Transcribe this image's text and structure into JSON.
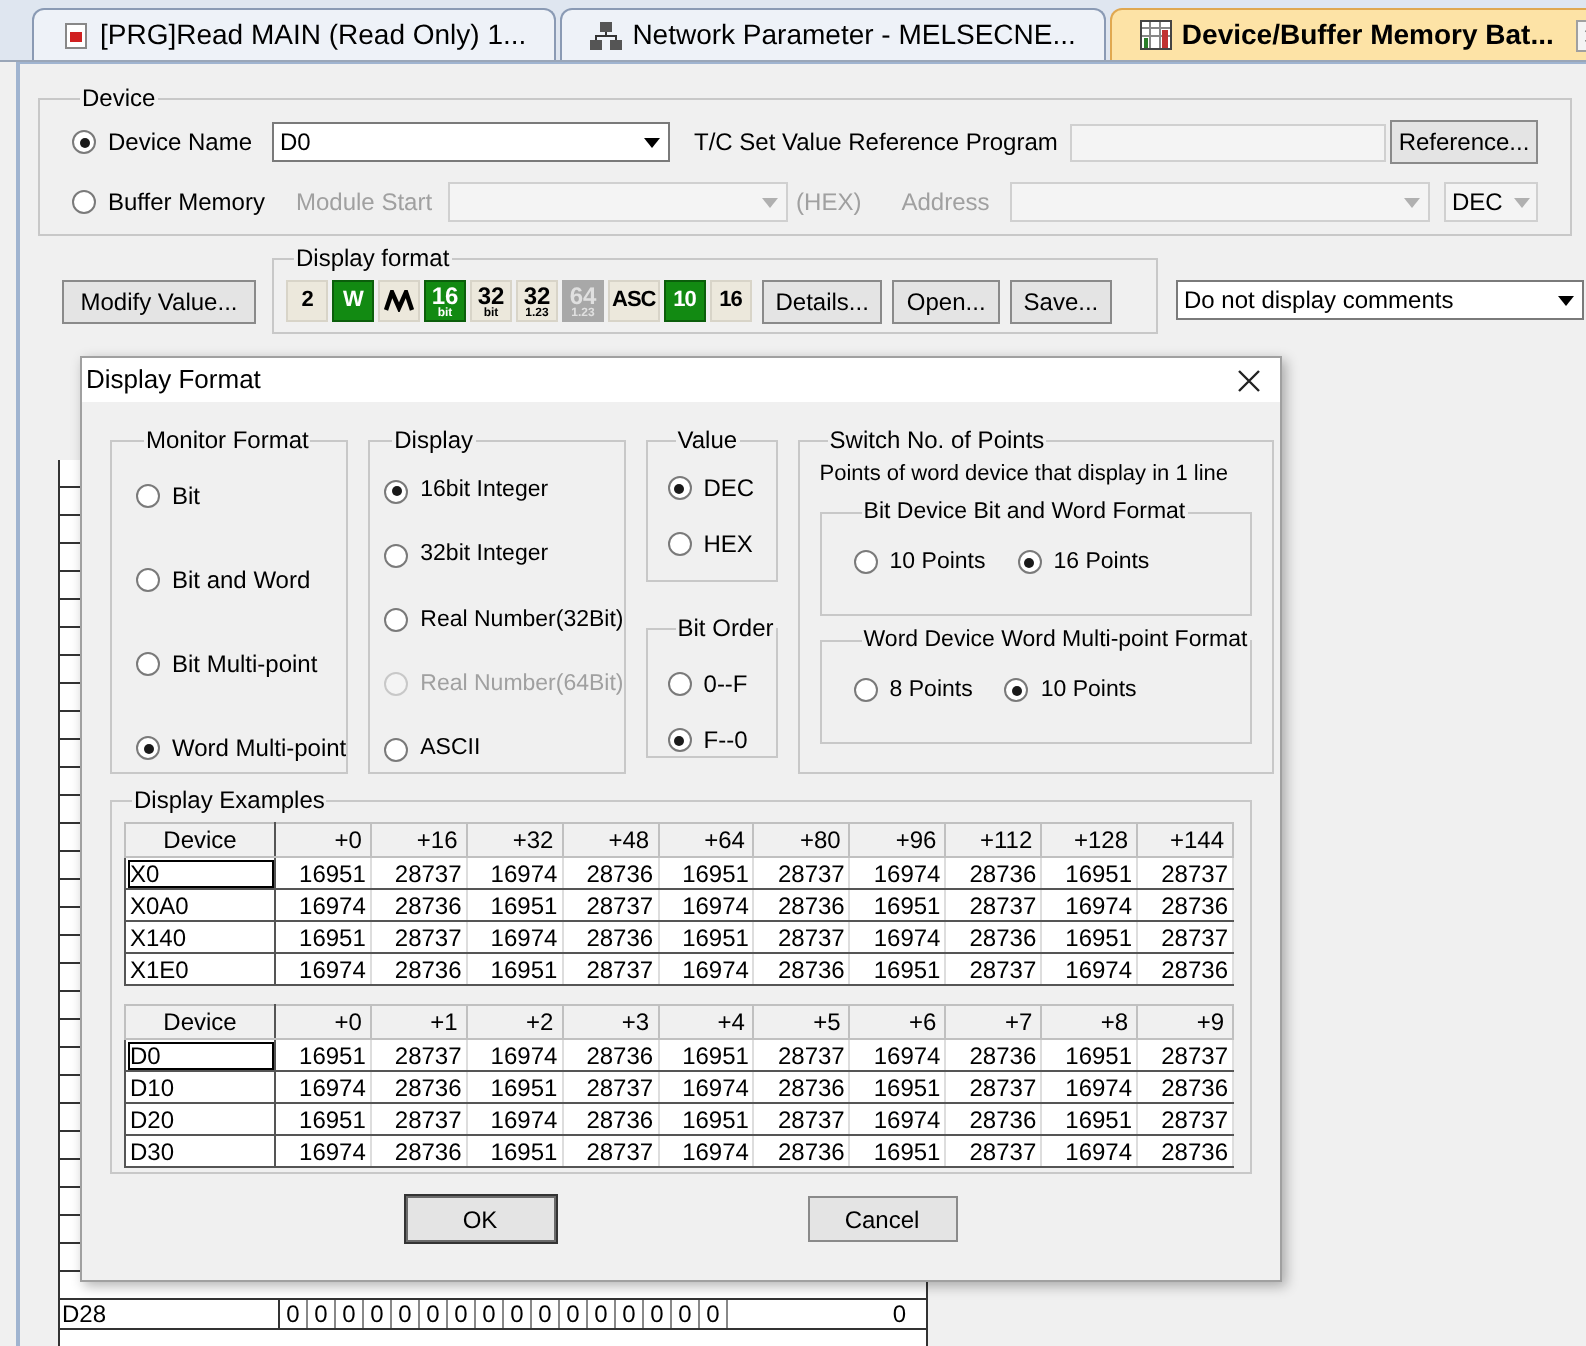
{
  "tabs": [
    {
      "label": "[PRG]Read MAIN (Read Only) 1...",
      "kind": "program",
      "selected": false
    },
    {
      "label": "Network Parameter - MELSECNE...",
      "kind": "network",
      "selected": false
    },
    {
      "label": "Device/Buffer Memory Bat...",
      "kind": "memory",
      "selected": true
    }
  ],
  "device_group": {
    "title": "Device",
    "device_name": {
      "label": "Device Name",
      "selected": true,
      "value": "D0"
    },
    "tc_label": "T/C Set Value Reference Program",
    "reference_button": "Reference...",
    "buffer_memory": {
      "label": "Buffer Memory",
      "selected": false
    },
    "module_start_label": "Module Start",
    "hex_label": "(HEX)",
    "address_label": "Address",
    "radix_value": "DEC"
  },
  "modify_value_button": "Modify Value...",
  "display_format": {
    "title": "Display format",
    "buttons": [
      {
        "kind": "text",
        "label": "2",
        "selected": false,
        "disabled": false
      },
      {
        "kind": "text",
        "label": "W",
        "selected": true,
        "disabled": false
      },
      {
        "kind": "icon",
        "selected": false,
        "disabled": false
      },
      {
        "kind": "stack",
        "label": "16",
        "sub": "bit",
        "selected": true,
        "disabled": false
      },
      {
        "kind": "stack",
        "label": "32",
        "sub": "bit",
        "selected": false,
        "disabled": false
      },
      {
        "kind": "stack",
        "label": "32",
        "sub": "1.23",
        "selected": false,
        "disabled": false
      },
      {
        "kind": "stack",
        "label": "64",
        "sub": "1.23",
        "selected": false,
        "disabled": true
      },
      {
        "kind": "text",
        "label": "ASC",
        "selected": false,
        "disabled": false
      },
      {
        "kind": "text",
        "label": "10",
        "selected": true,
        "disabled": false
      },
      {
        "kind": "text",
        "label": "16",
        "selected": false,
        "disabled": false
      }
    ],
    "actions": [
      "Details...",
      "Open...",
      "Save..."
    ]
  },
  "comment_select": "Do not display comments",
  "background_row": {
    "device": "D28",
    "bits": [
      "0",
      "0",
      "0",
      "0",
      "0",
      "0",
      "0",
      "0",
      "0",
      "0",
      "0",
      "0",
      "0",
      "0",
      "0",
      "0"
    ],
    "value": "0"
  },
  "dialog": {
    "title": "Display Format",
    "monitor_format": {
      "title": "Monitor Format",
      "options": [
        {
          "label": "Bit",
          "selected": false
        },
        {
          "label": "Bit and Word",
          "selected": false
        },
        {
          "label": "Bit Multi-point",
          "selected": false
        },
        {
          "label": "Word Multi-point",
          "selected": true
        }
      ]
    },
    "display": {
      "title": "Display",
      "options": [
        {
          "label": "16bit Integer",
          "selected": true,
          "disabled": false
        },
        {
          "label": "32bit Integer",
          "selected": false,
          "disabled": false
        },
        {
          "label": "Real Number(32Bit)",
          "selected": false,
          "disabled": false
        },
        {
          "label": "Real Number(64Bit)",
          "selected": false,
          "disabled": true
        },
        {
          "label": "ASCII",
          "selected": false,
          "disabled": false
        }
      ]
    },
    "value": {
      "title": "Value",
      "options": [
        {
          "label": "DEC",
          "selected": true
        },
        {
          "label": "HEX",
          "selected": false
        }
      ]
    },
    "bit_order": {
      "title": "Bit Order",
      "options": [
        {
          "label": "0--F",
          "selected": false
        },
        {
          "label": "F--0",
          "selected": true
        }
      ]
    },
    "switch_points": {
      "title": "Switch No. of Points",
      "note": "Points of word device that display in 1 line",
      "bit_device": {
        "title": "Bit Device  Bit and Word Format",
        "options": [
          {
            "label": "10 Points",
            "selected": false
          },
          {
            "label": "16 Points",
            "selected": true
          }
        ]
      },
      "word_device": {
        "title": "Word Device  Word Multi-point Format",
        "options": [
          {
            "label": "8 Points",
            "selected": false
          },
          {
            "label": "10 Points",
            "selected": true
          }
        ]
      }
    },
    "examples": {
      "title": "Display Examples",
      "tables": [
        {
          "columns": [
            "Device",
            "+0",
            "+16",
            "+32",
            "+48",
            "+64",
            "+80",
            "+96",
            "+112",
            "+128",
            "+144"
          ],
          "rows": [
            [
              "X0",
              "16951",
              "28737",
              "16974",
              "28736",
              "16951",
              "28737",
              "16974",
              "28736",
              "16951",
              "28737"
            ],
            [
              "X0A0",
              "16974",
              "28736",
              "16951",
              "28737",
              "16974",
              "28736",
              "16951",
              "28737",
              "16974",
              "28736"
            ],
            [
              "X140",
              "16951",
              "28737",
              "16974",
              "28736",
              "16951",
              "28737",
              "16974",
              "28736",
              "16951",
              "28737"
            ],
            [
              "X1E0",
              "16974",
              "28736",
              "16951",
              "28737",
              "16974",
              "28736",
              "16951",
              "28737",
              "16974",
              "28736"
            ]
          ]
        },
        {
          "columns": [
            "Device",
            "+0",
            "+1",
            "+2",
            "+3",
            "+4",
            "+5",
            "+6",
            "+7",
            "+8",
            "+9"
          ],
          "rows": [
            [
              "D0",
              "16951",
              "28737",
              "16974",
              "28736",
              "16951",
              "28737",
              "16974",
              "28736",
              "16951",
              "28737"
            ],
            [
              "D10",
              "16974",
              "28736",
              "16951",
              "28737",
              "16974",
              "28736",
              "16951",
              "28737",
              "16974",
              "28736"
            ],
            [
              "D20",
              "16951",
              "28737",
              "16974",
              "28736",
              "16951",
              "28737",
              "16974",
              "28736",
              "16951",
              "28737"
            ],
            [
              "D30",
              "16974",
              "28736",
              "16951",
              "28737",
              "16974",
              "28736",
              "16951",
              "28737",
              "16974",
              "28736"
            ]
          ]
        }
      ]
    },
    "ok_button": "OK",
    "cancel_button": "Cancel"
  }
}
